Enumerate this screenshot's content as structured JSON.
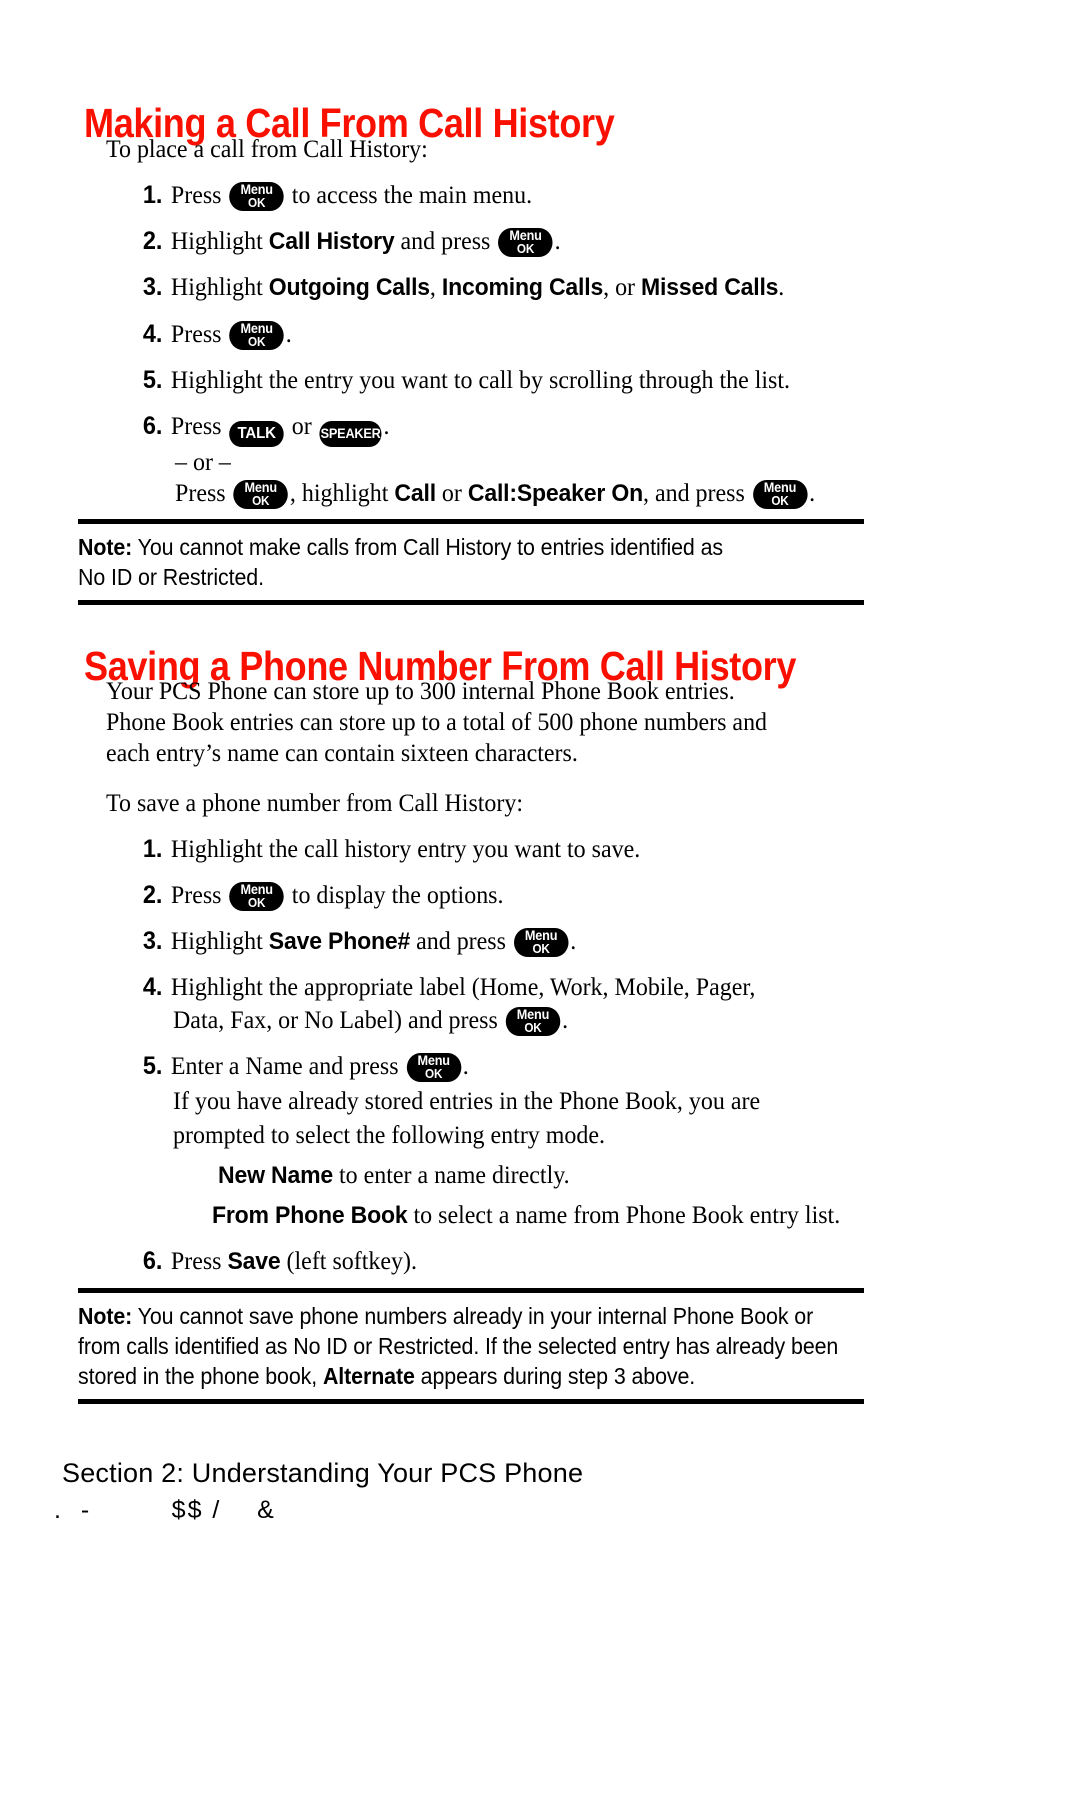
{
  "document": {
    "type": "phone-user-manual-page",
    "accent_color": "#F91000",
    "text_color": "#000000",
    "background_color": "#FFFFFF"
  },
  "sections": [
    {
      "heading": "Making a Call From Call History",
      "intro": "To place a call from Call History:",
      "steps": [
        {
          "num": "1.",
          "pre": "Press ",
          "key": "Menu/OK",
          "post": " to access the main menu."
        },
        {
          "num": "2.",
          "pre": "Highlight ",
          "strong": "Call History",
          "mid": " and press ",
          "key": "Menu/OK",
          "post": "."
        },
        {
          "num": "3.",
          "pre": "Highlight ",
          "strong": "Outgoing Calls",
          "sep1": ", ",
          "strong2": "Incoming Calls",
          "sep2": ", or ",
          "strong3": "Missed Calls",
          "post": "."
        },
        {
          "num": "4.",
          "pre": "Press ",
          "key": "Menu/OK",
          "post": "."
        },
        {
          "num": "5.",
          "pre": "Highlight the entry you want to call by scrolling through the list."
        },
        {
          "num": "6.",
          "pre": "Press ",
          "key": "TALK",
          "mid": " or ",
          "key2": "SPEAKER",
          "post": "."
        }
      ],
      "or_divider": "– or –",
      "alt_line": {
        "pre": "Press ",
        "key": "Menu/OK",
        "mid": ", highlight ",
        "strong": "Call",
        "mid2": " or ",
        "strong2": "Call:Speaker On",
        "mid3": ", and press ",
        "key2": "Menu/OK",
        "post": "."
      },
      "note": {
        "label": "Note:",
        "lines": [
          "You cannot make calls from Call History to entries identified as",
          "No ID or Restricted."
        ]
      }
    },
    {
      "heading": "Saving a Phone Number From Call History",
      "paragraph_lines": [
        "Your PCS Phone can store up to 300 internal Phone Book entries.",
        "Phone Book entries can store up to a total of 500 phone numbers and",
        "each entry’s name can contain sixteen characters."
      ],
      "intro": "To save a phone number from Call History:",
      "steps": [
        {
          "num": "1.",
          "pre": "Highlight the call history entry you want to save."
        },
        {
          "num": "2.",
          "pre": "Press ",
          "key": "Menu/OK",
          "post": " to display the options."
        },
        {
          "num": "3.",
          "pre": "Highlight ",
          "strong": "Save Phone#",
          "mid": " and press ",
          "key": "Menu/OK",
          "post": "."
        },
        {
          "num": "4.",
          "pre": "Highlight the appropriate label (Home, Work, Mobile, Pager,",
          "cont": {
            "pre": "Data, Fax, or No Label) and press ",
            "key": "Menu/OK",
            "post": "."
          }
        },
        {
          "num": "5.",
          "pre": "Enter a Name and press ",
          "key": "Menu/OK",
          "post": ".",
          "cont_lines": [
            "If you have already stored entries in the Phone Book, you are",
            "prompted to select the following entry mode."
          ],
          "sub_items": [
            {
              "strong": "New Name",
              "text": " to enter a name directly."
            },
            {
              "strong": "From Phone Book",
              "text": " to select a name from Phone Book entry list."
            }
          ]
        },
        {
          "num": "6.",
          "pre": "Press ",
          "strong": "Save",
          "post": " (left softkey)."
        }
      ],
      "note": {
        "label": "Note:",
        "lines": [
          "You cannot save phone numbers already in your internal Phone Book or",
          "from calls identified as No ID or Restricted. If the selected entry has already been",
          "stored in the phone book, |Alternate| appears during step 3 above."
        ],
        "line3_pre": "stored in the phone book, ",
        "line3_strong": "Alternate",
        "line3_post": " appears during step 3 above."
      }
    }
  ],
  "keys": {
    "menu_ok": {
      "line1": "Menu",
      "line2": "OK"
    },
    "talk": "TALK",
    "speaker": "SPEAKER"
  },
  "footer": {
    "section_label": "Section 2: Understanding Your PCS Phone",
    "page_number_artifact": ".  -         $$ /    &"
  }
}
